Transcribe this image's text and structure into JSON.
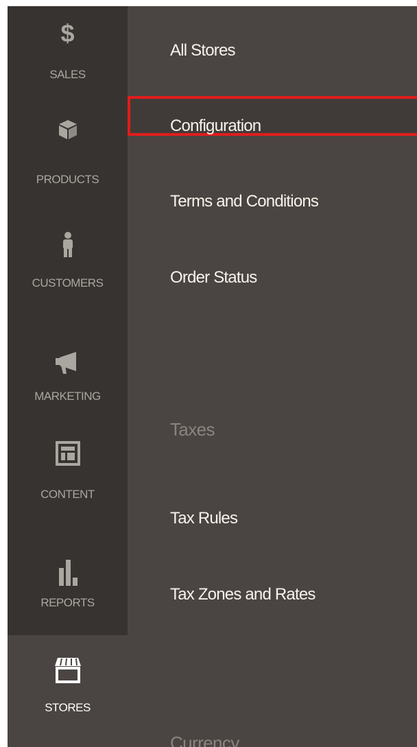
{
  "sidebar": {
    "items": [
      {
        "label": "SALES",
        "icon": "dollar-icon"
      },
      {
        "label": "PRODUCTS",
        "icon": "box-icon"
      },
      {
        "label": "CUSTOMERS",
        "icon": "person-icon"
      },
      {
        "label": "MARKETING",
        "icon": "megaphone-icon"
      },
      {
        "label": "CONTENT",
        "icon": "layout-icon"
      },
      {
        "label": "REPORTS",
        "icon": "bar-chart-icon"
      },
      {
        "label": "STORES",
        "icon": "storefront-icon",
        "active": true
      }
    ]
  },
  "submenu": {
    "items": [
      {
        "label": "All Stores"
      },
      {
        "label": "Configuration",
        "highlighted": true
      },
      {
        "label": "Terms and Conditions"
      },
      {
        "label": "Order Status"
      }
    ],
    "taxes_heading": "Taxes",
    "tax_items": [
      {
        "label": "Tax Rules"
      },
      {
        "label": "Tax Zones and Rates"
      }
    ],
    "currency_heading": "Currency"
  },
  "colors": {
    "sidebar_bg": "#373330",
    "submenu_bg": "#4a4542",
    "highlight_border": "#e21c1c",
    "text": "#f7f3eb",
    "heading": "#8b847e"
  }
}
